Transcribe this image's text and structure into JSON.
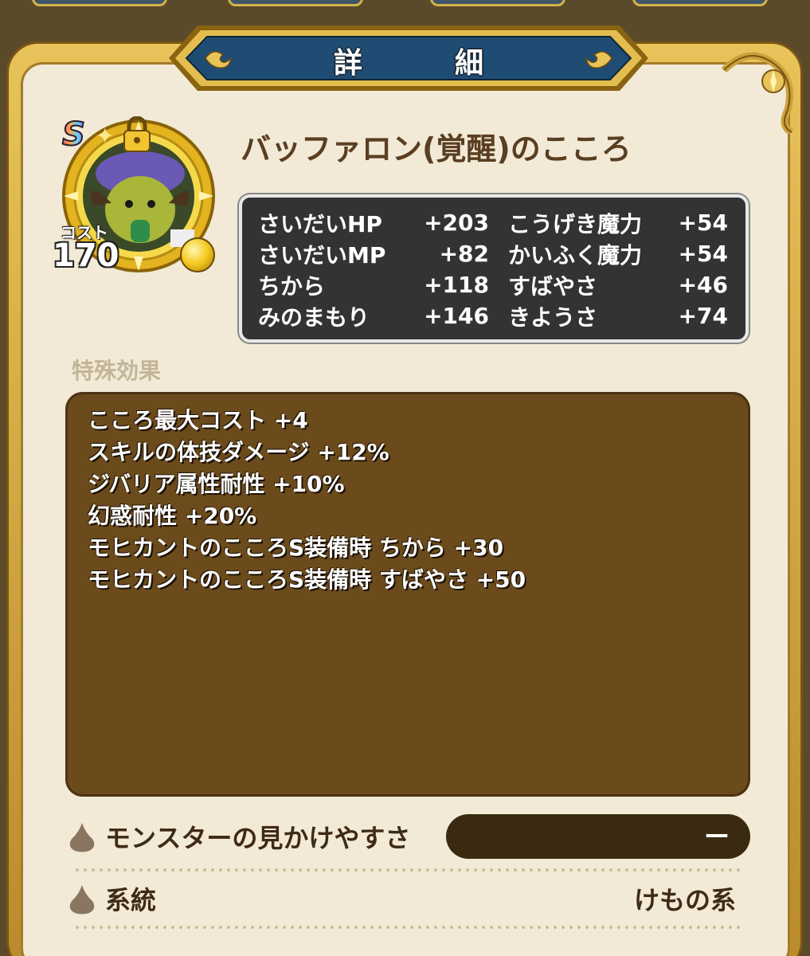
{
  "window": {
    "title": "詳　細"
  },
  "monster": {
    "rank": "S",
    "name": "バッファロン(覚醒)のこころ",
    "cost_label": "コスト",
    "cost_value": "170"
  },
  "stats": [
    {
      "label": "さいだいHP",
      "value": "+203"
    },
    {
      "label": "こうげき魔力",
      "value": "+54"
    },
    {
      "label": "さいだいMP",
      "value": "+82"
    },
    {
      "label": "かいふく魔力",
      "value": "+54"
    },
    {
      "label": "ちから",
      "value": "+118"
    },
    {
      "label": "すばやさ",
      "value": "+46"
    },
    {
      "label": "みのまもり",
      "value": "+146"
    },
    {
      "label": "きようさ",
      "value": "+74"
    }
  ],
  "effects": {
    "heading": "特殊効果",
    "lines": [
      "こころ最大コスト +4",
      "スキルの体技ダメージ +12%",
      "ジバリア属性耐性 +10%",
      "幻惑耐性 +20%",
      "モヒカントのこころS装備時 ちから +30",
      "モヒカントのこころS装備時 すばやさ +50"
    ]
  },
  "info": {
    "visibility_label": "モンスターの見かけやすさ",
    "visibility_value": "ー",
    "lineage_label": "系統",
    "lineage_value": "けもの系"
  },
  "colors": {
    "banner": "#1f4c73",
    "frame_gold": "#d4ab3f",
    "panel_bg": "#f2ead6",
    "effects_bg": "#6b4a1c",
    "stats_bg": "#333333"
  }
}
